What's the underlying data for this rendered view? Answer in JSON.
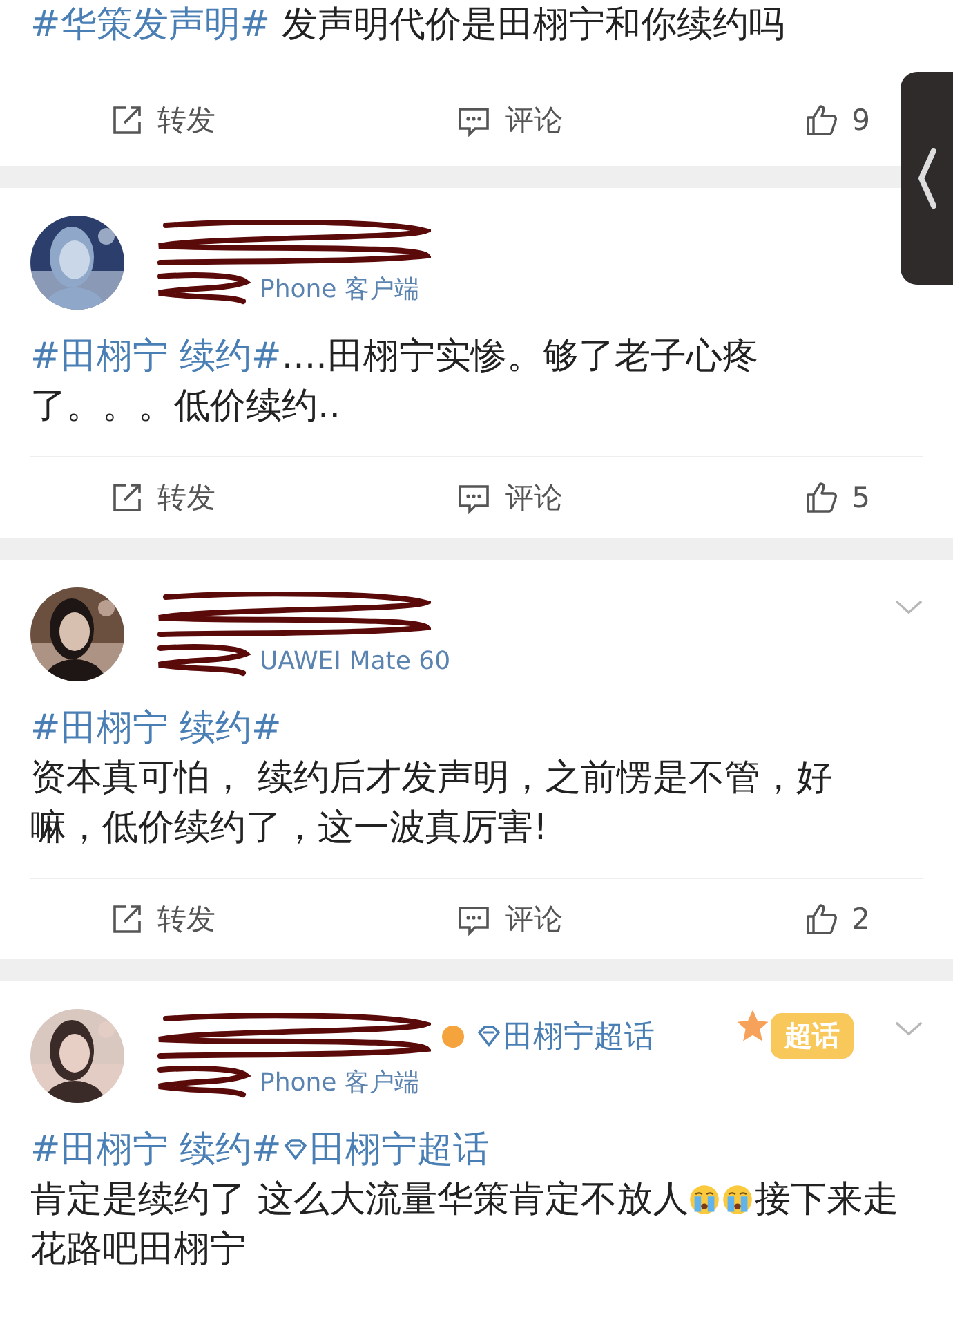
{
  "posts": [
    {
      "text": [
        {
          "kind": "tag",
          "text": "#华策发声明#"
        },
        {
          "kind": "text",
          "text": " 发声明代价是田栩宁和你续约吗"
        }
      ],
      "actions": {
        "repost": "转发",
        "comment": "评论",
        "likes": "9"
      }
    },
    {
      "header": {
        "device": "Phone 客户端"
      },
      "text": [
        {
          "kind": "tag",
          "text": "#田栩宁 续约#"
        },
        {
          "kind": "text",
          "text": "....田栩宁实惨。够了老子心疼了。。。低价续约.."
        }
      ],
      "actions": {
        "repost": "转发",
        "comment": "评论",
        "likes": "5"
      }
    },
    {
      "header": {
        "device": "UAWEI Mate 60",
        "menu": true
      },
      "tag_line": [
        {
          "kind": "tag",
          "text": "#田栩宁 续约#"
        }
      ],
      "text": [
        {
          "kind": "text",
          "text": "资本真可怕， 续约后才发声明，之前愣是不管，好嘛，低价续约了，这一波真厉害!"
        }
      ],
      "actions": {
        "repost": "转发",
        "comment": "评论",
        "likes": "2"
      }
    },
    {
      "header": {
        "device": "Phone 客户端",
        "topic": "田栩宁超话",
        "sticker": "超话",
        "menu": true
      },
      "tag_line": [
        {
          "kind": "tag",
          "text": "#田栩宁 续约#"
        },
        {
          "kind": "topic",
          "text": "田栩宁超话"
        }
      ],
      "text": [
        {
          "kind": "text",
          "text": "肯定是续约了 这么大流量华策肯定不放人"
        },
        {
          "kind": "emoji"
        },
        {
          "kind": "emoji"
        },
        {
          "kind": "text",
          "text": "接下来走花路吧田栩宁"
        }
      ]
    }
  ]
}
